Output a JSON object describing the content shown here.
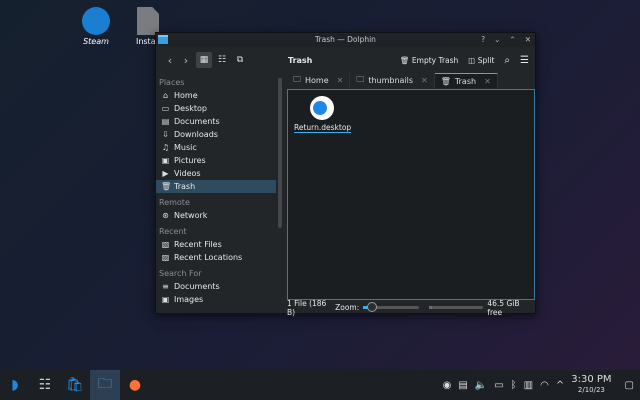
{
  "desktop": {
    "icons": [
      {
        "label": "Steam"
      },
      {
        "label": "Install"
      }
    ]
  },
  "window": {
    "title": "Trash — Dolphin",
    "location": "Trash",
    "empty_trash": "Empty Trash",
    "split": "Split",
    "tabs": [
      {
        "label": "Home"
      },
      {
        "label": "thumbnails"
      },
      {
        "label": "Trash"
      }
    ],
    "sidebar": {
      "places": "Places",
      "remote": "Remote",
      "recent": "Recent",
      "search_for": "Search For",
      "place_items": [
        "Home",
        "Desktop",
        "Documents",
        "Downloads",
        "Music",
        "Pictures",
        "Videos",
        "Trash"
      ],
      "remote_items": [
        "Network"
      ],
      "recent_items": [
        "Recent Files",
        "Recent Locations"
      ],
      "search_items": [
        "Documents",
        "Images"
      ]
    },
    "files": [
      {
        "name": "Return.desktop"
      }
    ],
    "status": {
      "summary": "1 File (186 B)",
      "zoom_label": "Zoom:",
      "zoom_percent": 15,
      "free": "46.5 GiB free",
      "disk_used_fraction": 0.05
    }
  },
  "taskbar": {
    "time": "3:30 PM",
    "date": "2/10/23"
  }
}
